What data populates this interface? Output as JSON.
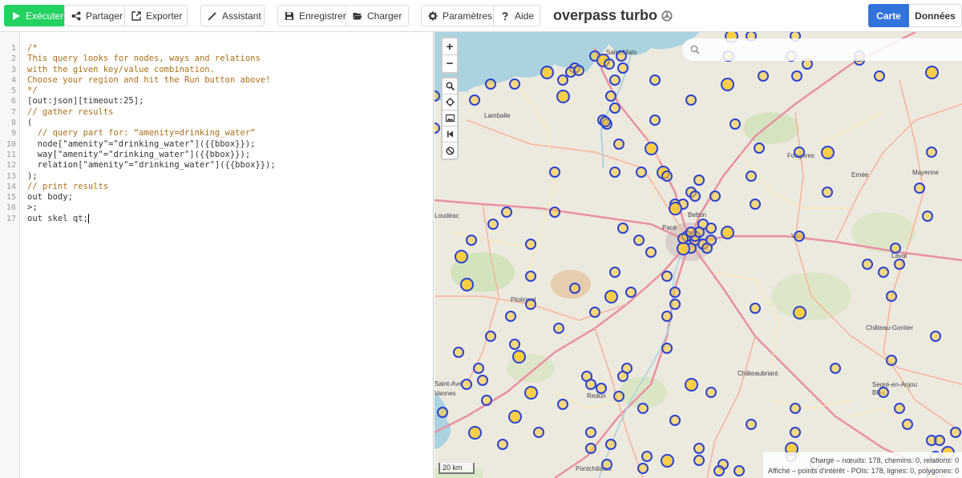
{
  "toolbar": {
    "run_label": "Exécuter",
    "share_label": "Partager",
    "export_label": "Exporter",
    "wizard_label": "Assistant",
    "save_label": "Enregistrer",
    "load_label": "Charger",
    "settings_label": "Paramètres",
    "help_label": "Aide",
    "brand": "overpass turbo",
    "view_map_label": "Carte",
    "view_data_label": "Données",
    "colors": {
      "run": "#23d160",
      "map_active": "#3273dc"
    }
  },
  "editor": {
    "line_numbers": [
      "1",
      "2",
      "3",
      "4",
      "5",
      "6",
      "7",
      "8",
      "9",
      "10",
      "11",
      "12",
      "13",
      "14",
      "15",
      "16",
      "17"
    ],
    "lines": [
      "/*",
      "This query looks for nodes, ways and relations",
      "with the given key/value combination.",
      "Choose your region and hit the Run button above!",
      "*/",
      "[out:json][timeout:25];",
      "// gather results",
      "(",
      "  // query part for: “amenity=drinking_water”",
      "  node[\"amenity\"=\"drinking_water\"]({{bbox}});",
      "  way[\"amenity\"=\"drinking_water\"]({{bbox}});",
      "  relation[\"amenity\"=\"drinking_water\"]({{bbox}});",
      ");",
      "// print results",
      "out body;",
      ">;",
      "out skel qt;"
    ]
  },
  "map": {
    "zoom_in": "+",
    "zoom_out": "−",
    "scale_label": "20 km",
    "status_line1": "Chargé – nœuds: 178, chemins: 0, relations: 0",
    "status_line2": "Affiché – points d'intérêt - POIs: 178, lignes: 0, polygones: 0",
    "places": [
      {
        "id": "saint-malo",
        "label": "Saint-Malo"
      },
      {
        "id": "lamballe",
        "label": "Lamballe"
      },
      {
        "id": "fougeres",
        "label": "Fougères"
      },
      {
        "id": "ernee",
        "label": "Ernée"
      },
      {
        "id": "mayenne",
        "label": "Mayenne"
      },
      {
        "id": "loudeac",
        "label": "Loudéac"
      },
      {
        "id": "betton",
        "label": "Betton"
      },
      {
        "id": "pace",
        "label": "Pacé"
      },
      {
        "id": "vitre",
        "label": "Vitré"
      },
      {
        "id": "laval",
        "label": "Laval"
      },
      {
        "id": "ploermel",
        "label": "Ploërmel"
      },
      {
        "id": "chateau-gontier",
        "label": "Château-Gontier"
      },
      {
        "id": "chateaubriant",
        "label": "Châteaubriant"
      },
      {
        "id": "saint-ave",
        "label": "Saint-Avé"
      },
      {
        "id": "vannes",
        "label": "Vannes"
      },
      {
        "id": "redon",
        "label": "Redon"
      },
      {
        "id": "segre",
        "label": "Segré-en-Anjou Bleu"
      },
      {
        "id": "pontchateau",
        "label": "Pontchâteau"
      }
    ],
    "colors": {
      "poi_stroke": "#2a42d6",
      "poi_fill": "#ffcc33",
      "sea": "#aad3df"
    }
  }
}
